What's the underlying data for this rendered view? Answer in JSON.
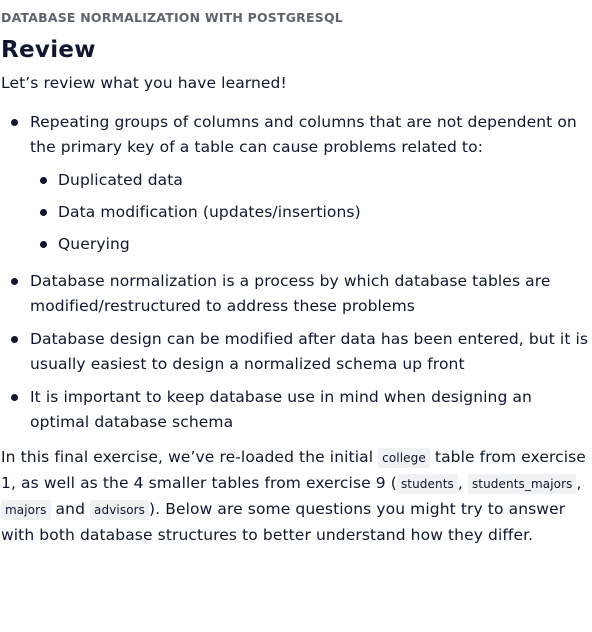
{
  "header": {
    "eyebrow": "DATABASE NORMALIZATION WITH POSTGRESQL",
    "title": "Review"
  },
  "intro": "Let’s review what you have learned!",
  "bullets": [
    "Repeating groups of columns and columns that are not dependent on the primary key of a table can cause problems related to:",
    "Database normalization is a process by which database tables are modified/restructured to address these problems",
    "Database design can be modified after data has been entered, but it is usually easiest to design a normalized schema up front",
    "It is important to keep database use in mind when designing an optimal database schema"
  ],
  "sub_bullets": [
    "Duplicated data",
    "Data modification (updates/insertions)",
    "Querying"
  ],
  "closing": {
    "t1": "In this final exercise, we’ve re-loaded the initial ",
    "code1": "college",
    "t2": " table from exercise 1, as well as the 4 smaller tables from exercise 9 (",
    "code2": "students",
    "t3": ", ",
    "code3": "students_majors",
    "t4": ", ",
    "code4": "majors",
    "t5": " and ",
    "code5": "advisors",
    "t6": "). Below are some questions you might try to answer with both database structures to better understand how they differ."
  }
}
